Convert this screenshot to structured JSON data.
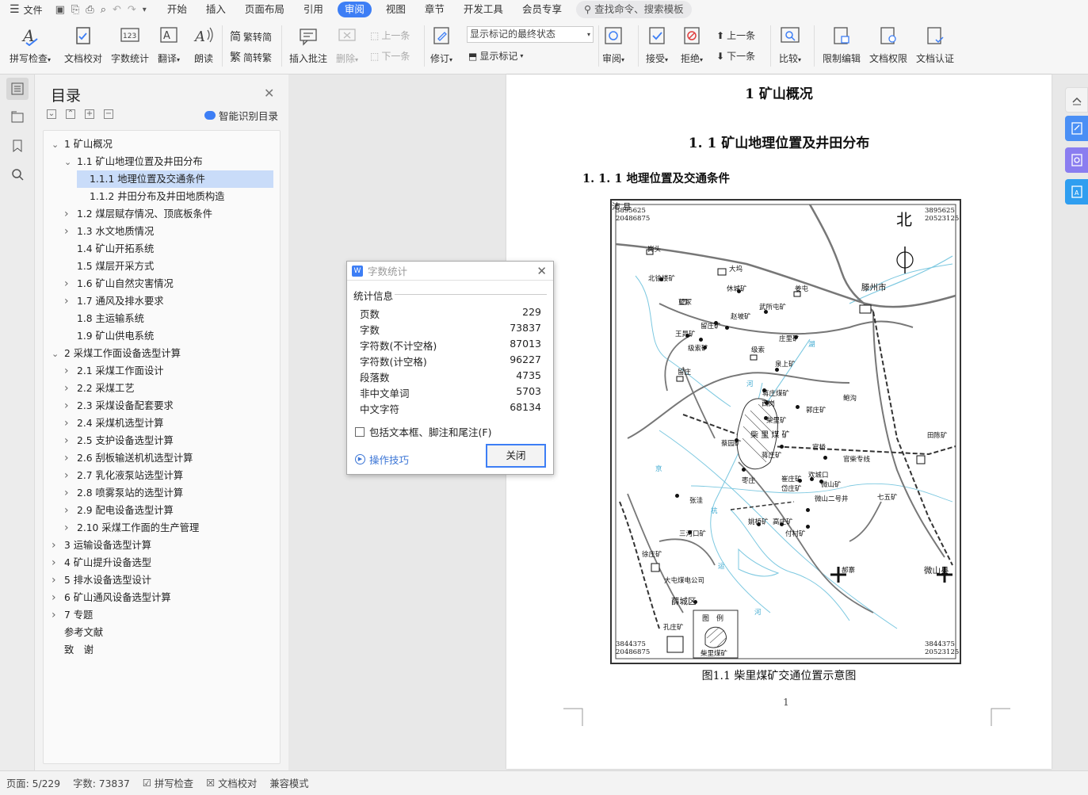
{
  "menubar": {
    "file": "文件",
    "tabs": [
      "开始",
      "插入",
      "页面布局",
      "引用",
      "审阅",
      "视图",
      "章节",
      "开发工具",
      "会员专享"
    ],
    "active_tab": "审阅",
    "search": "查找命令、搜索模板"
  },
  "toolbar": {
    "spell_check": "拼写检查",
    "doc_proof": "文档校对",
    "word_count": "字数统计",
    "translate": "翻译",
    "read_aloud": "朗读",
    "trad_to_simp": "繁转简",
    "simp_to_trad": "简转繁",
    "insert_comment": "插入批注",
    "delete": "删除",
    "prev_comment": "上一条",
    "next_comment": "下一条",
    "revise": "修订",
    "markup_select": "显示标记的最终状态",
    "show_markup": "显示标记",
    "review": "审阅",
    "accept": "接受",
    "reject": "拒绝",
    "prev_change": "上一条",
    "next_change": "下一条",
    "compare": "比较",
    "restrict_edit": "限制编辑",
    "doc_rights": "文档权限",
    "doc_auth": "文档认证"
  },
  "toc": {
    "title": "目录",
    "smart": "智能识别目录",
    "items": [
      {
        "label": "1 矿山概况",
        "level": 0,
        "state": "open"
      },
      {
        "label": "1.1 矿山地理位置及井田分布",
        "level": 1,
        "state": "open"
      },
      {
        "label": "1.1.1 地理位置及交通条件",
        "level": 2,
        "state": "none",
        "selected": true
      },
      {
        "label": "1.1.2 井田分布及井田地质构造",
        "level": 2,
        "state": "none"
      },
      {
        "label": "1.2 煤层赋存情况、顶底板条件",
        "level": 1,
        "state": "closed"
      },
      {
        "label": "1.3 水文地质情况",
        "level": 1,
        "state": "closed"
      },
      {
        "label": "1.4 矿山开拓系统",
        "level": 1,
        "state": "none"
      },
      {
        "label": "1.5 煤层开采方式",
        "level": 1,
        "state": "none"
      },
      {
        "label": "1.6 矿山自然灾害情况",
        "level": 1,
        "state": "closed"
      },
      {
        "label": "1.7 通风及排水要求",
        "level": 1,
        "state": "closed"
      },
      {
        "label": "1.8 主运输系统",
        "level": 1,
        "state": "none"
      },
      {
        "label": "1.9 矿山供电系统",
        "level": 1,
        "state": "none"
      },
      {
        "label": "2 采煤工作面设备选型计算",
        "level": 0,
        "state": "open"
      },
      {
        "label": "2.1 采煤工作面设计",
        "level": 1,
        "state": "closed"
      },
      {
        "label": "2.2  采煤工艺",
        "level": 1,
        "state": "closed"
      },
      {
        "label": "2.3 采煤设备配套要求",
        "level": 1,
        "state": "closed"
      },
      {
        "label": "2.4  采煤机选型计算",
        "level": 1,
        "state": "closed"
      },
      {
        "label": "2.5 支护设备选型计算",
        "level": 1,
        "state": "closed"
      },
      {
        "label": "2.6 刮板输送机机选型计算",
        "level": 1,
        "state": "closed"
      },
      {
        "label": "2.7  乳化液泵站选型计算",
        "level": 1,
        "state": "closed"
      },
      {
        "label": "2.8 喷雾泵站的选型计算",
        "level": 1,
        "state": "closed"
      },
      {
        "label": "2.9  配电设备选型计算",
        "level": 1,
        "state": "closed"
      },
      {
        "label": "2.10 采煤工作面的生产管理",
        "level": 1,
        "state": "closed"
      },
      {
        "label": "3 运输设备选型计算",
        "level": 0,
        "state": "closed"
      },
      {
        "label": "4 矿山提升设备选型",
        "level": 0,
        "state": "closed"
      },
      {
        "label": "5 排水设备选型设计",
        "level": 0,
        "state": "closed"
      },
      {
        "label": "6 矿山通风设备选型计算",
        "level": 0,
        "state": "closed"
      },
      {
        "label": "7 专题",
        "level": 0,
        "state": "closed"
      },
      {
        "label": "参考文献",
        "level": 0,
        "state": "none"
      },
      {
        "label": "致　谢",
        "level": 0,
        "state": "none"
      }
    ]
  },
  "document": {
    "heading1": "1 矿山概况",
    "heading2": "1. 1 矿山地理位置及井田分布",
    "heading3": "1. 1. 1 地理位置及交通条件",
    "caption": "图1.1  柴里煤矿交通位置示意图",
    "page_number": "1",
    "map": {
      "north": "北",
      "coords": {
        "tl1": "3895625",
        "tl2": "20486875",
        "tr1": "3895625",
        "tr2": "20523125",
        "bl1": "3844375",
        "bl2": "20486875",
        "br1": "3844375",
        "br2": "20523125"
      },
      "places": [
        "岗头",
        "大坞",
        "北徐楼矿",
        "休城矿",
        "姜屯",
        "滕州市",
        "望冢",
        "赵坡矿",
        "武所屯矿",
        "留庄矿",
        "王晁矿",
        "级索矿",
        "级索",
        "庄里矿",
        "泉上矿",
        "留庄",
        "西岗",
        "蒋庄煤矿",
        "郭庄矿",
        "鲍沟",
        "柴里矿",
        "柴 里 煤 矿",
        "蔡园矿",
        "蒋庄矿",
        "官桥",
        "官柴专线",
        "田陈矿",
        "枣庄",
        "崔庄矿",
        "岱庄矿",
        "欢城口",
        "微山矿",
        "微山二号井",
        "七五矿",
        "张洼",
        "姚桥矿",
        "高庄矿",
        "付村矿",
        "三河口矿",
        "徐庄矿",
        "大屯煤电公司",
        "郝寨",
        "微山县",
        "薛城区",
        "孔庄矿",
        "沛 县"
      ],
      "legend_title": "图　例",
      "legend_item": "柴里煤矿",
      "river_labels": [
        "湖",
        "河",
        "京",
        "杭",
        "运",
        "河"
      ]
    }
  },
  "dialog": {
    "title": "字数统计",
    "section": "统计信息",
    "stats": [
      {
        "label": "页数",
        "value": "229"
      },
      {
        "label": "字数",
        "value": "73837"
      },
      {
        "label": "字符数(不计空格)",
        "value": "87013"
      },
      {
        "label": "字符数(计空格)",
        "value": "96227"
      },
      {
        "label": "段落数",
        "value": "4735"
      },
      {
        "label": "非中文单词",
        "value": "5703"
      },
      {
        "label": "中文字符",
        "value": "68134"
      }
    ],
    "include_label": "包括文本框、脚注和尾注(F)",
    "tips": "操作技巧",
    "close_button": "关闭"
  },
  "statusbar": {
    "page": "页面: 5/229",
    "words": "字数: 73837",
    "spell": "拼写检查",
    "proof": "文档校对",
    "compat": "兼容模式"
  },
  "colors": {
    "accent": "#3d7ef5",
    "selected": "#c9dcf9",
    "side_button": "#4a8ff5",
    "side_button_purple": "#8a7df0"
  }
}
